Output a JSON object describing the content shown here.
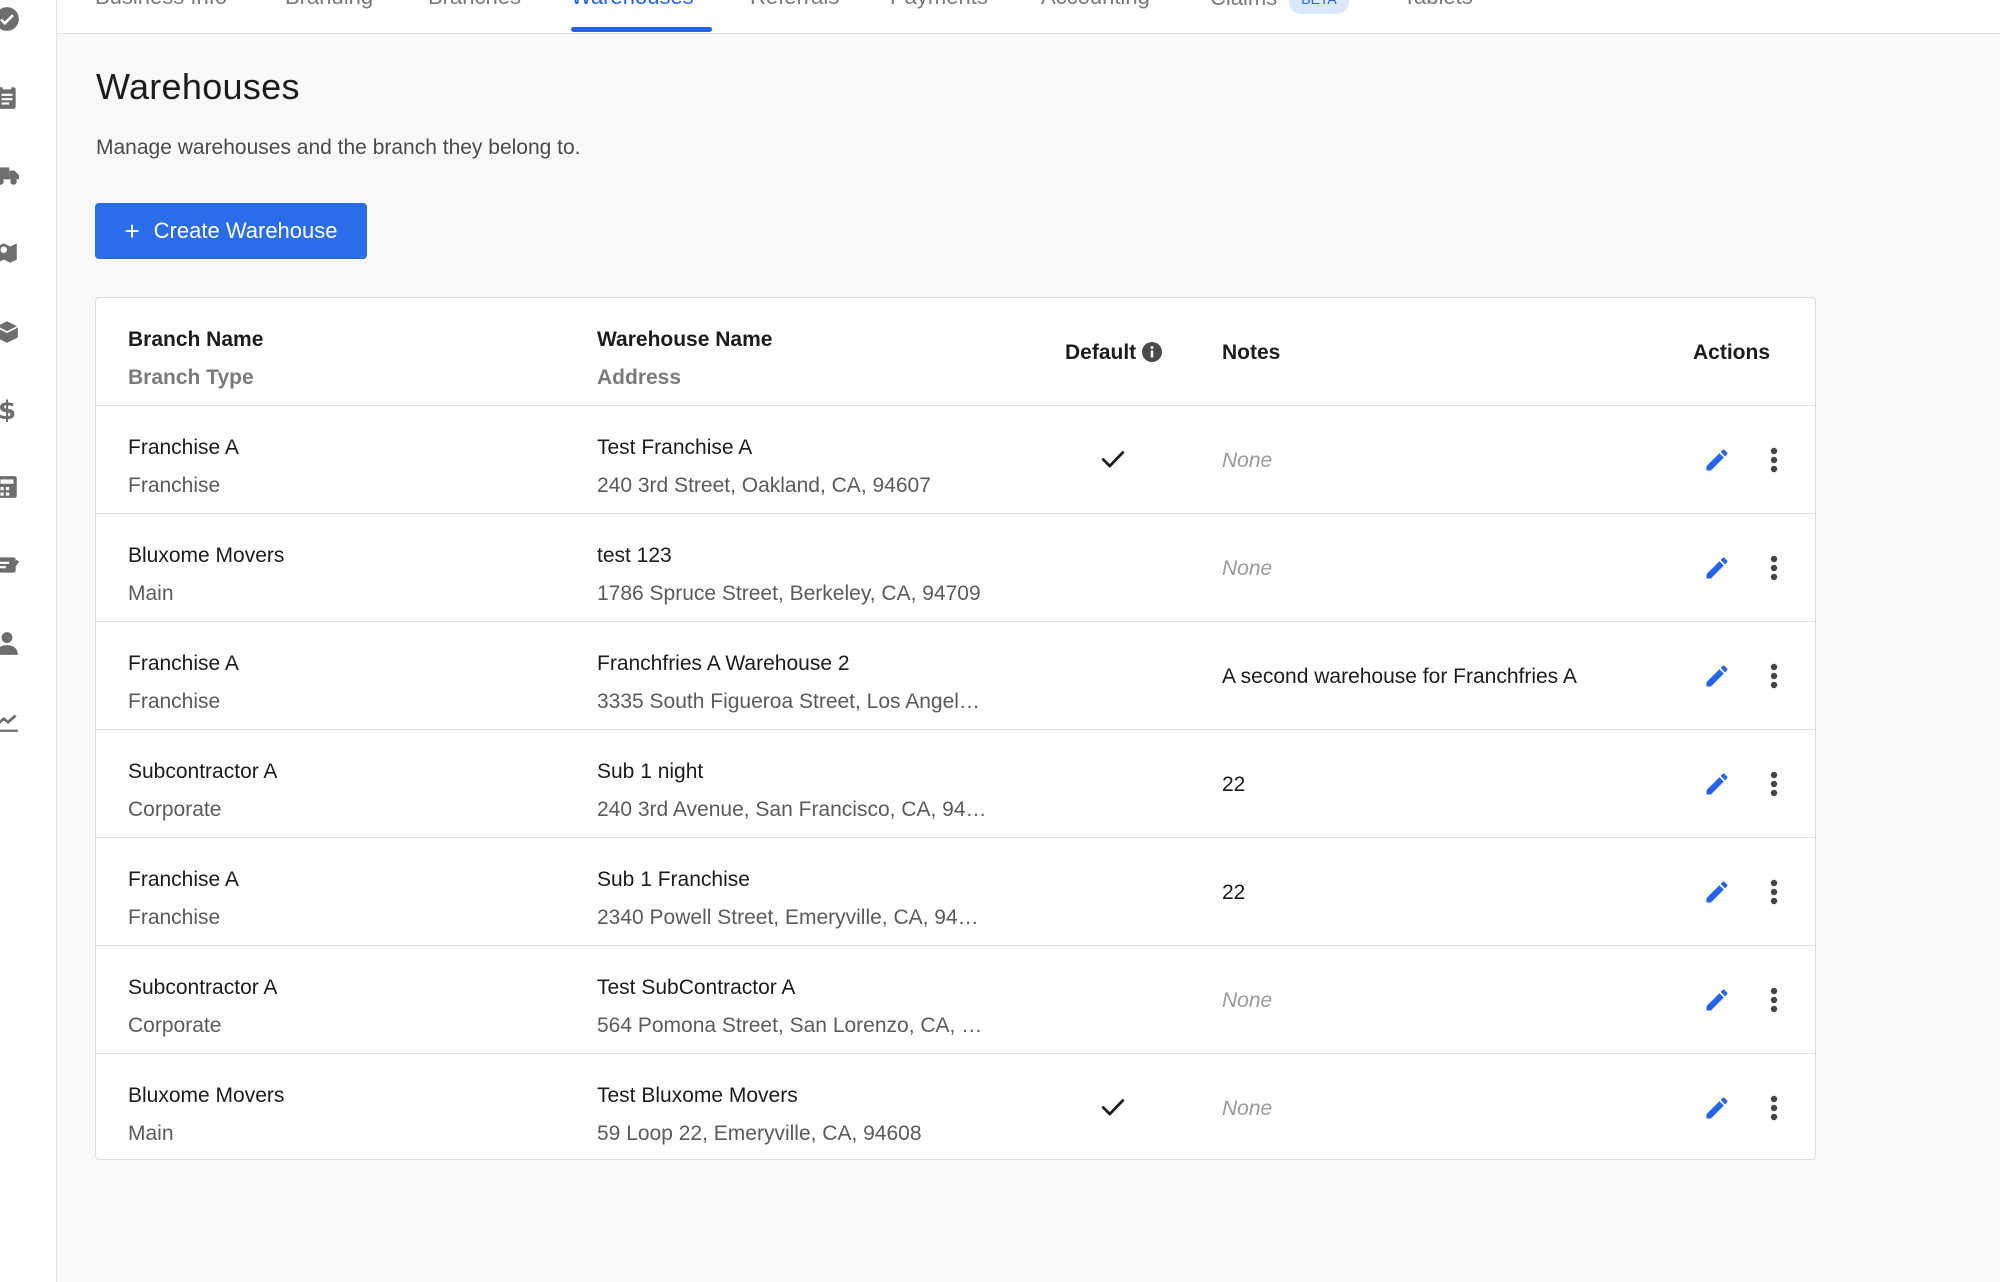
{
  "tabs": [
    {
      "label": "Business Info"
    },
    {
      "label": "Branding"
    },
    {
      "label": "Branches"
    },
    {
      "label": "Warehouses",
      "active": true
    },
    {
      "label": "Referrals"
    },
    {
      "label": "Payments"
    },
    {
      "label": "Accounting"
    },
    {
      "label": "Claims",
      "badge": "BETA"
    },
    {
      "label": "Tablets"
    }
  ],
  "sidebar": {
    "icons": [
      "check-circle-icon",
      "clipboard-icon",
      "truck-icon",
      "map-icon",
      "box-icon",
      "dollar-icon",
      "calculator-icon",
      "ticket-icon",
      "user-icon",
      "chart-icon"
    ]
  },
  "page": {
    "title": "Warehouses",
    "subtitle": "Manage warehouses and the branch they belong to.",
    "create_button": "Create Warehouse"
  },
  "table": {
    "headers": {
      "branch_name": "Branch Name",
      "branch_type": "Branch Type",
      "warehouse_name": "Warehouse Name",
      "address": "Address",
      "default": "Default",
      "notes": "Notes",
      "actions": "Actions"
    },
    "rows": [
      {
        "branch_name": "Franchise A",
        "branch_type": "Franchise",
        "warehouse_name": "Test Franchise A",
        "address": "240 3rd Street, Oakland, CA, 94607",
        "default": true,
        "notes": "None",
        "notes_empty": true
      },
      {
        "branch_name": "Bluxome Movers",
        "branch_type": "Main",
        "warehouse_name": "test 123",
        "address": "1786 Spruce Street, Berkeley, CA, 94709",
        "default": false,
        "notes": "None",
        "notes_empty": true
      },
      {
        "branch_name": "Franchise A",
        "branch_type": "Franchise",
        "warehouse_name": "Franchfries A Warehouse 2",
        "address": "3335 South Figueroa Street, Los Angel…",
        "default": false,
        "notes": "A second warehouse for Franchfries A",
        "notes_empty": false
      },
      {
        "branch_name": "Subcontractor A",
        "branch_type": "Corporate",
        "warehouse_name": "Sub 1 night",
        "address": "240 3rd Avenue, San Francisco, CA, 94…",
        "default": false,
        "notes": "22",
        "notes_empty": false
      },
      {
        "branch_name": "Franchise A",
        "branch_type": "Franchise",
        "warehouse_name": "Sub 1 Franchise",
        "address": "2340 Powell Street, Emeryville, CA, 94…",
        "default": false,
        "notes": "22",
        "notes_empty": false
      },
      {
        "branch_name": "Subcontractor A",
        "branch_type": "Corporate",
        "warehouse_name": "Test SubContractor A",
        "address": "564 Pomona Street, San Lorenzo, CA, …",
        "default": false,
        "notes": "None",
        "notes_empty": true
      },
      {
        "branch_name": "Bluxome Movers",
        "branch_type": "Main",
        "warehouse_name": "Test Bluxome Movers",
        "address": "59 Loop 22, Emeryville, CA, 94608",
        "default": true,
        "notes": "None",
        "notes_empty": true
      }
    ]
  },
  "colors": {
    "accent": "#2563eb",
    "button": "#2b6de8",
    "badge_bg": "#dbe8ff"
  }
}
